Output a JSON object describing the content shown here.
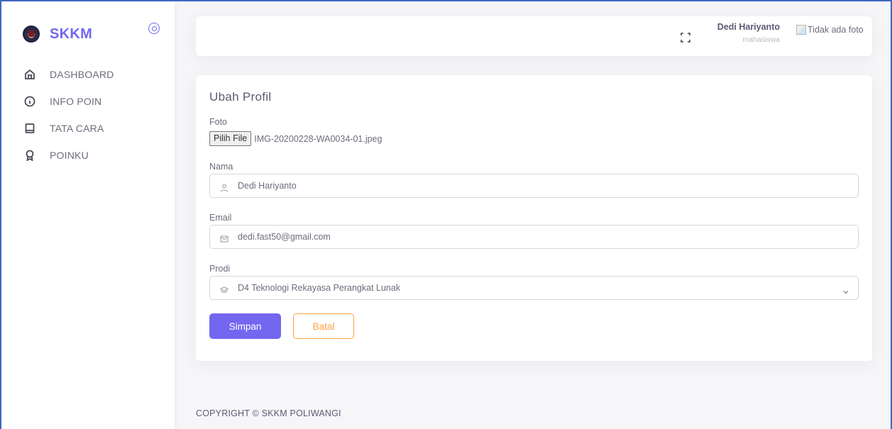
{
  "app": {
    "brand_name": "SKKM",
    "accent_color": "#7367f0"
  },
  "sidebar": {
    "items": [
      {
        "label": "DASHBOARD",
        "icon": "home-icon"
      },
      {
        "label": "INFO POIN",
        "icon": "info-icon"
      },
      {
        "label": "TATA CARA",
        "icon": "book-icon"
      },
      {
        "label": "POINKU",
        "icon": "award-icon"
      }
    ]
  },
  "header": {
    "user_name": "Dedi Hariyanto",
    "user_role": "mahasiswa",
    "avatar_alt": "Tidak ada foto"
  },
  "form": {
    "title": "Ubah Profil",
    "foto_label": "Foto",
    "file_button_label": "Pilih File",
    "file_name": "IMG-20200228-WA0034-01.jpeg",
    "nama_label": "Nama",
    "nama_value": "Dedi Hariyanto",
    "email_label": "Email",
    "email_value": "dedi.fast50@gmail.com",
    "prodi_label": "Prodi",
    "prodi_value": "D4 Teknologi Rekayasa Perangkat Lunak",
    "save_label": "Simpan",
    "cancel_label": "Batal",
    "cancel_color": "#ff9f43"
  },
  "footer": {
    "text": "COPYRIGHT © SKKM POLIWANGI"
  }
}
